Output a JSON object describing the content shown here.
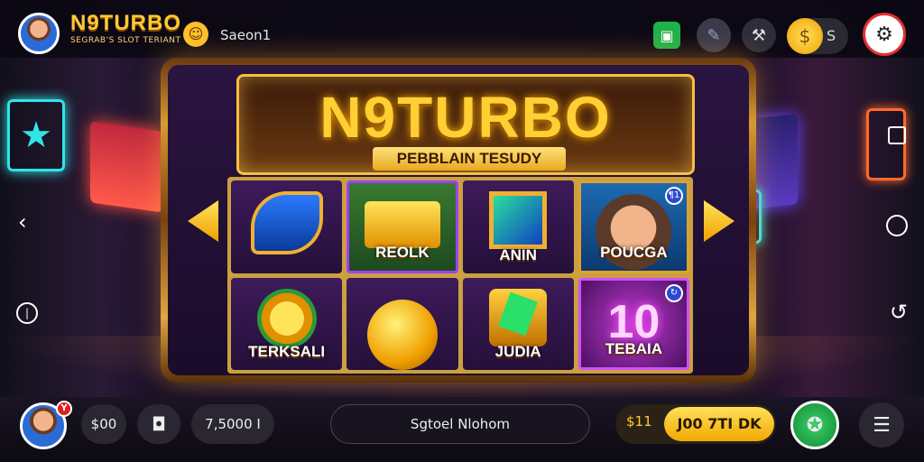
{
  "header": {
    "brand_title": "N9TURBO",
    "brand_subtitle": "SEGRAB'S SLOT TERIANT",
    "label": "Saeon1",
    "coin_value": "S"
  },
  "machine": {
    "logo_title": "N9TURBO",
    "banner": "PEBBLAIN TESUDY",
    "tiles": [
      {
        "label": ""
      },
      {
        "label": "REOLK"
      },
      {
        "label": "ANIN"
      },
      {
        "label": "POUCGA"
      },
      {
        "label": "TERKSALI"
      },
      {
        "label": ""
      },
      {
        "label": "JUDIA"
      },
      {
        "label": "TEBAIA"
      }
    ],
    "ten_value": "10",
    "badge1": "¶1",
    "badge2": "↻"
  },
  "footer": {
    "credit": "$00",
    "balance": "7,5000 I",
    "status": "Sgtoel Nlohom",
    "mini_coin": "$11",
    "gold_button": "J00 7TI DK",
    "notif": "Y"
  },
  "icons": [
    "wallet-icon",
    "ticket-icon",
    "tools-icon",
    "coin-icon",
    "settings-icon",
    "back-icon",
    "power-icon",
    "square-icon",
    "circle-icon",
    "rotate-icon",
    "chat-icon",
    "spin-icon",
    "menu-icon"
  ],
  "colors": {
    "accent_gold": "#ffc933",
    "spin_green": "#1fb24a",
    "settings_ring": "#e03030"
  }
}
